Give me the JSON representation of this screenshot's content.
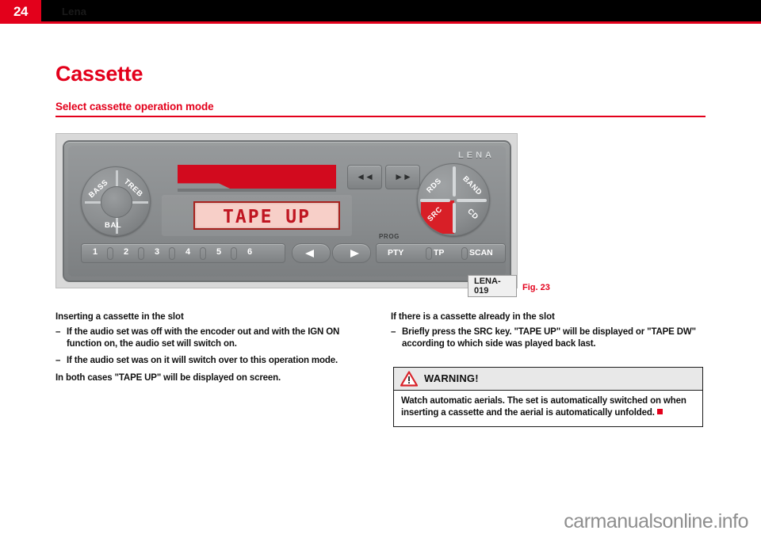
{
  "header": {
    "page_number": "24",
    "title": "Lena"
  },
  "titles": {
    "main": "Cassette",
    "sub": "Select cassette operation mode"
  },
  "figure": {
    "code": "LENA-019",
    "number": "Fig. 23",
    "brand": "LENA",
    "lcd_text": "TAPE UP",
    "tone_knob": {
      "bass": "BASS",
      "treb": "TREB",
      "bal": "BAL"
    },
    "source_knob": {
      "rds": "RDS",
      "band": "BAND",
      "src": "SRC",
      "cd": "CD"
    },
    "seek": {
      "rewind": "◄◄",
      "forward": "►►"
    },
    "presets": [
      "1",
      "2",
      "3",
      "4",
      "5",
      "6"
    ],
    "prog_label": "PROG",
    "function_keys": {
      "pty": "PTY",
      "tp": "TP",
      "scan": "SCAN"
    },
    "accent_red": "#d20a1e",
    "body_grey": "#8b8e90"
  },
  "left_column": {
    "heading": "Inserting a cassette in the slot",
    "bullets": [
      "If the audio set was off with the encoder out and with the IGN ON function on, the audio set will switch on.",
      "If the audio set was on it will switch over to this operation mode."
    ],
    "paragraph": "In both cases \"TAPE UP\" will be displayed on screen."
  },
  "right_column": {
    "heading": "If there is a cassette already in the slot",
    "bullets": [
      "Briefly press the SRC key. \"TAPE UP\" will be displayed or \"TAPE DW\" according to which side was played back last."
    ]
  },
  "warning": {
    "icon": "warning-triangle-icon",
    "title": "WARNING!",
    "body": "Watch automatic aerials. The set is automatically switched on when inserting a cassette and the aerial is automatically unfolded."
  },
  "watermark": "carmanualsonline.info",
  "colors": {
    "brand_red": "#e3001b",
    "black": "#000000"
  }
}
